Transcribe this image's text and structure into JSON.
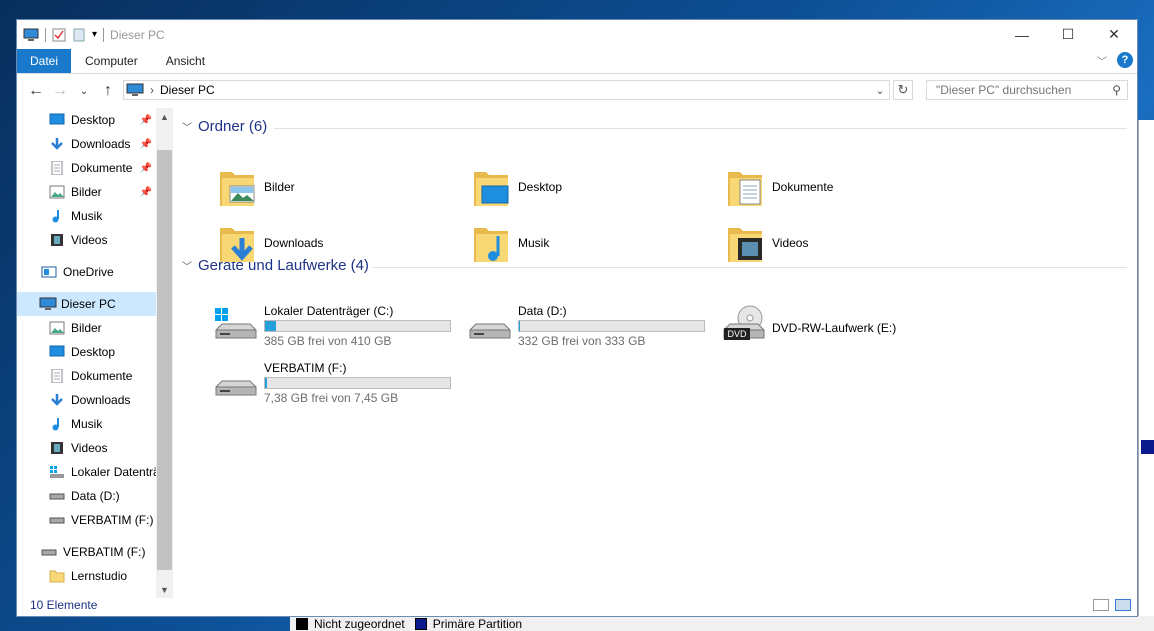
{
  "window": {
    "title": "Dieser PC"
  },
  "ribbon": {
    "tabs": [
      "Datei",
      "Computer",
      "Ansicht"
    ]
  },
  "address": {
    "path": "Dieser PC",
    "search_placeholder": "\"Dieser PC\" durchsuchen"
  },
  "sidebar": {
    "quick_access": [
      {
        "label": "Desktop",
        "icon": "desktop-icon"
      },
      {
        "label": "Downloads",
        "icon": "downloads-icon"
      },
      {
        "label": "Dokumente",
        "icon": "documents-icon"
      },
      {
        "label": "Bilder",
        "icon": "pictures-icon"
      },
      {
        "label": "Musik",
        "icon": "music-icon"
      },
      {
        "label": "Videos",
        "icon": "videos-icon"
      }
    ],
    "onedrive": "OneDrive",
    "this_pc": "Dieser PC",
    "this_pc_children": [
      {
        "label": "Bilder",
        "icon": "pictures-icon"
      },
      {
        "label": "Desktop",
        "icon": "desktop-icon"
      },
      {
        "label": "Dokumente",
        "icon": "documents-icon"
      },
      {
        "label": "Downloads",
        "icon": "downloads-icon"
      },
      {
        "label": "Musik",
        "icon": "music-icon"
      },
      {
        "label": "Videos",
        "icon": "videos-icon"
      },
      {
        "label": "Lokaler Datenträ",
        "icon": "windows-drive-icon"
      },
      {
        "label": "Data (D:)",
        "icon": "drive-icon"
      },
      {
        "label": "VERBATIM (F:)",
        "icon": "drive-icon"
      }
    ],
    "usb": "VERBATIM (F:)",
    "usb_child": "Lernstudio"
  },
  "content": {
    "folders_header": "Ordner (6)",
    "folders": [
      {
        "label": "Bilder",
        "icon": "pictures-folder-icon"
      },
      {
        "label": "Desktop",
        "icon": "desktop-folder-icon"
      },
      {
        "label": "Dokumente",
        "icon": "documents-folder-icon"
      },
      {
        "label": "Downloads",
        "icon": "downloads-folder-icon"
      },
      {
        "label": "Musik",
        "icon": "music-folder-icon"
      },
      {
        "label": "Videos",
        "icon": "videos-folder-icon"
      }
    ],
    "drives_header": "Geräte und Laufwerke (4)",
    "drives": [
      {
        "label": "Lokaler Datenträger (C:)",
        "free": "385 GB frei von 410 GB",
        "used_fraction": 0.061,
        "icon": "windows-drive-icon"
      },
      {
        "label": "Data (D:)",
        "free": "332 GB frei von 333 GB",
        "used_fraction": 0.003,
        "icon": "drive-icon"
      },
      {
        "label": "DVD-RW-Laufwerk (E:)",
        "icon": "dvd-drive-icon"
      },
      {
        "label": "VERBATIM (F:)",
        "free": "7,38 GB frei von 7,45 GB",
        "used_fraction": 0.009,
        "icon": "drive-icon"
      }
    ]
  },
  "status": {
    "count": "10 Elemente"
  },
  "background": {
    "legend_unallocated": "Nicht zugeordnet",
    "legend_primary": "Primäre Partition"
  },
  "colors": {
    "accent": "#1979ca",
    "progress": "#26a0da",
    "header": "#1e3287"
  }
}
